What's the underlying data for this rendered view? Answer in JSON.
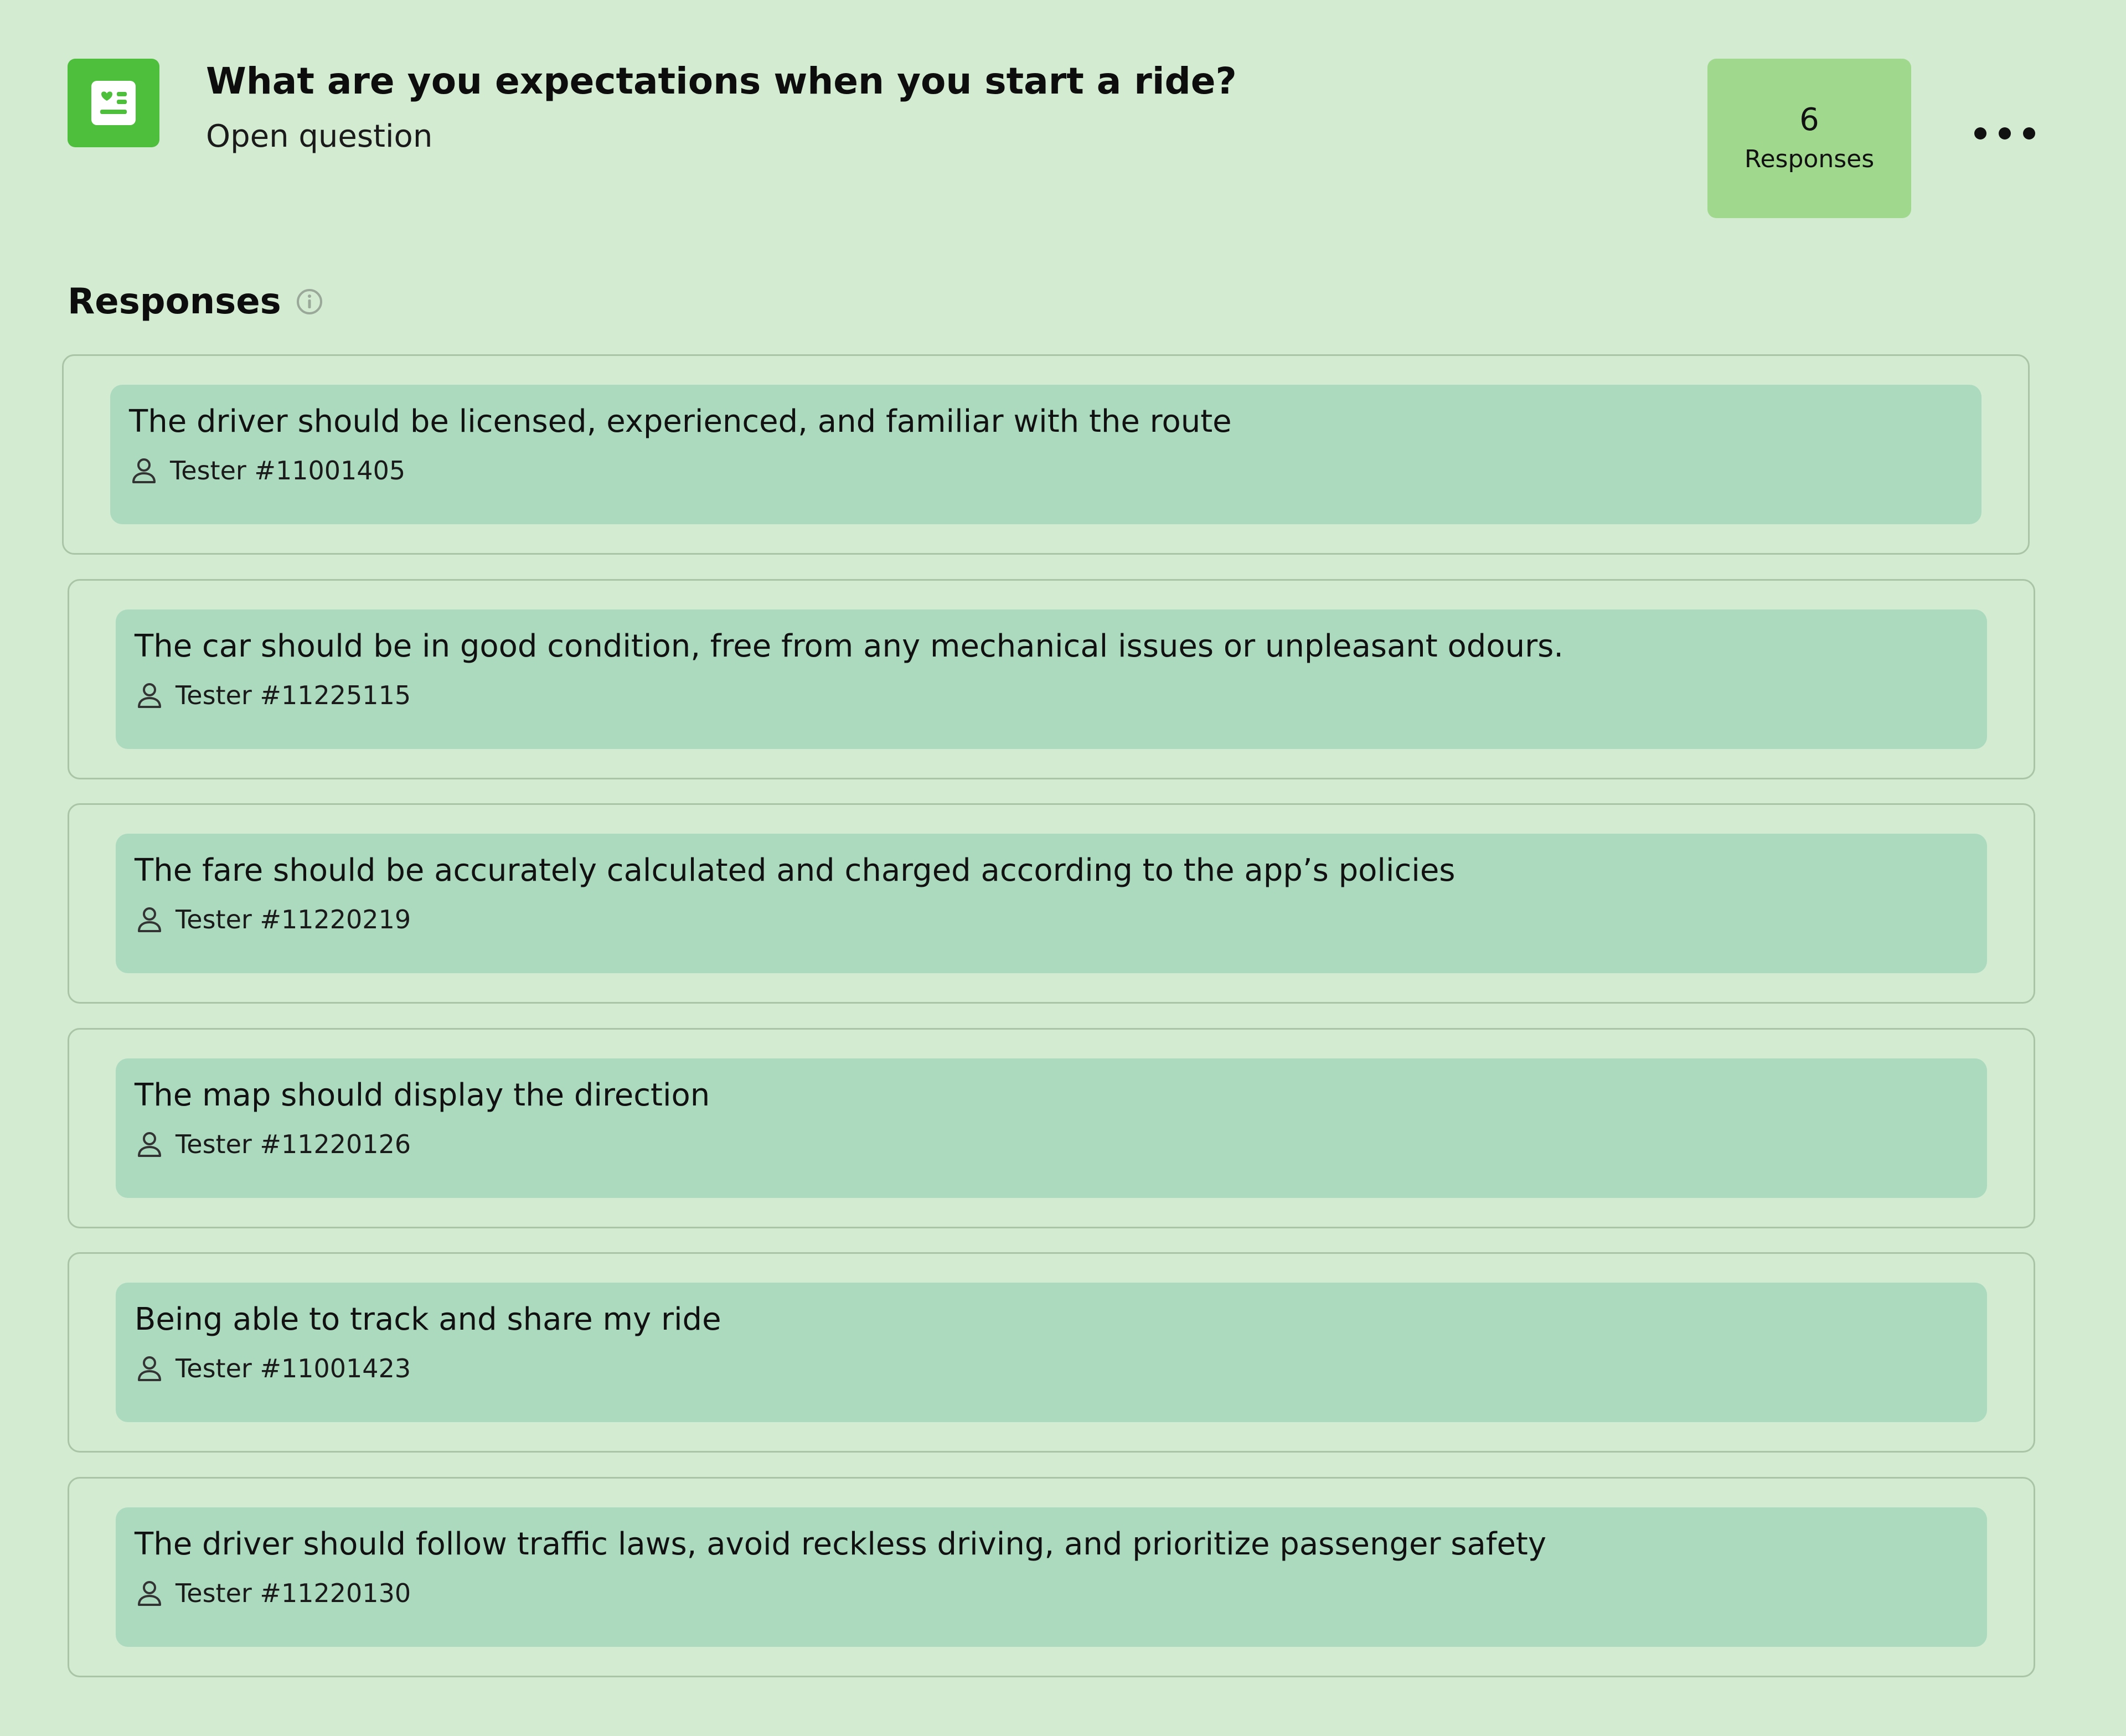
{
  "question": {
    "title": "What are you expectations when you start a ride?",
    "type": "Open question",
    "icon": "survey-icon",
    "response_count": "6",
    "response_count_label": "Responses"
  },
  "responses_section": {
    "title": "Responses",
    "info_icon": "info-icon"
  },
  "responses": [
    {
      "text": "The driver should be licensed, experienced, and familiar with the route",
      "tester": "Tester #11001405"
    },
    {
      "text": "The car should be in good condition, free from any mechanical issues or unpleasant odours.",
      "tester": "Tester #11225115"
    },
    {
      "text": "The fare should be accurately calculated and charged according to the app’s policies",
      "tester": "Tester #11220219"
    },
    {
      "text": "The map should display the direction",
      "tester": "Tester #11220126"
    },
    {
      "text": "Being able to track and share my ride",
      "tester": "Tester #11001423"
    },
    {
      "text": "The driver should follow traffic laws, avoid reckless driving, and prioritize passenger safety",
      "tester": "Tester #11220130"
    }
  ],
  "colors": {
    "background": "#d3ecd1",
    "accent": "#4ebe3d",
    "badge": "#a0d88e",
    "response_fill": "#acdabe"
  }
}
